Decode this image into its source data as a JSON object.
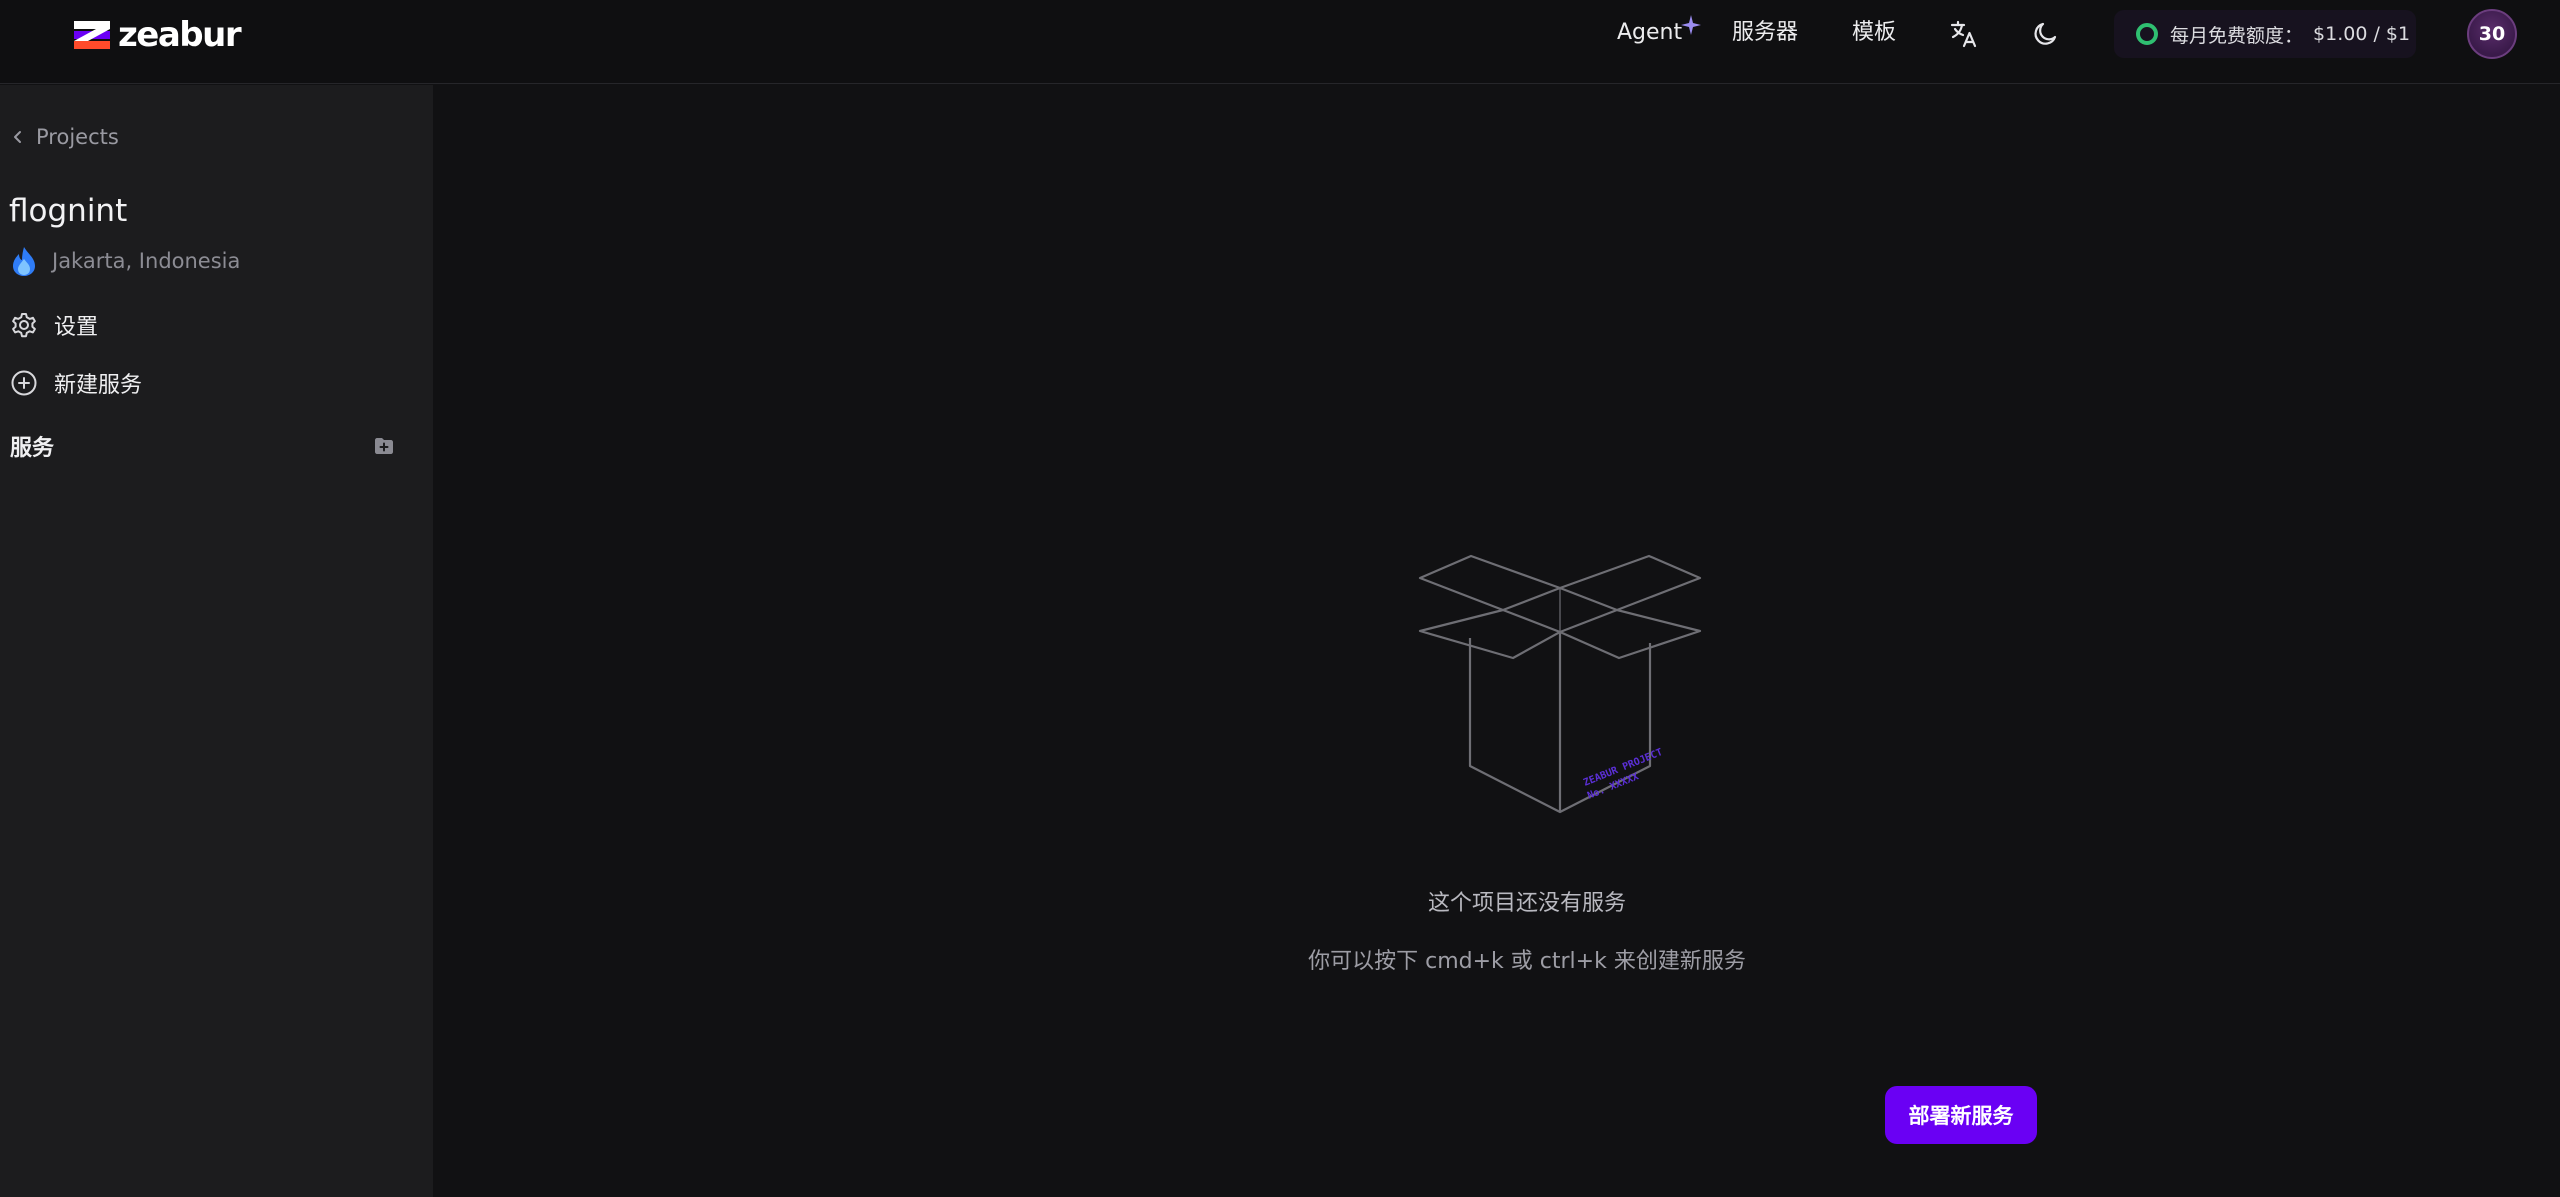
{
  "brand": {
    "name": "zeabur"
  },
  "topnav": {
    "agent_label": "Agent",
    "servers_label": "服务器",
    "templates_label": "模板",
    "quota_label": "每月免费额度：",
    "quota_value": "$1.00 / $1",
    "avatar_text": "30"
  },
  "sidebar": {
    "back_label": "Projects",
    "project_name": "flognint",
    "region": "Jakarta, Indonesia",
    "settings_label": "设置",
    "new_service_label": "新建服务",
    "services_section_label": "服务"
  },
  "empty_state": {
    "title": "这个项目还没有服务",
    "hint": "你可以按下 cmd+k 或 ctrl+k 来创建新服务",
    "deploy_button_label": "部署新服务"
  },
  "colors": {
    "accent": "#6a00f4",
    "quota_ring": "#2fbf71",
    "sidebar_bg": "#1c1c1e",
    "main_bg": "#111113"
  },
  "icons": {
    "agent": "sparkle-icon",
    "translate": "translate-icon",
    "theme": "moon-icon",
    "back": "chevron-left-icon",
    "region": "flame-icon",
    "settings": "gear-icon",
    "new_service": "plus-circle-icon",
    "add_folder": "folder-plus-icon"
  }
}
